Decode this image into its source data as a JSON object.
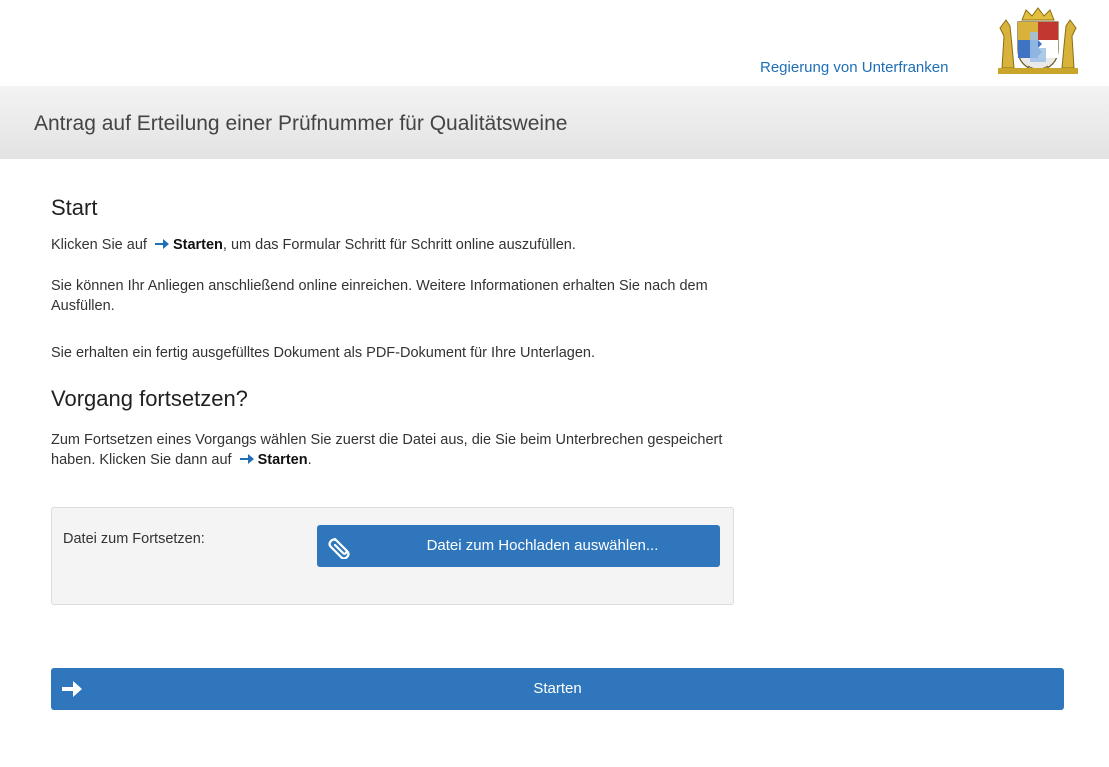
{
  "header": {
    "authority_label": "Regierung von Unterfranken",
    "coat_of_arms_icon": "bavaria-coat-of-arms-icon"
  },
  "title_bar": {
    "title": "Antrag auf Erteilung einer Prüfnummer für Qualitätsweine"
  },
  "start_section": {
    "heading": "Start",
    "para1_before": "Klicken Sie auf",
    "para1_link": "Starten",
    "para1_after": ", um das Formular Schritt für Schritt online auszufüllen.",
    "para2": "Sie können Ihr Anliegen anschließend online einreichen. Weitere Informationen erhalten Sie nach dem Ausfüllen.",
    "para3": "Sie erhalten ein fertig ausgefülltes Dokument als PDF-Dokument für Ihre Unterlagen."
  },
  "continue_section": {
    "heading": "Vorgang fortsetzen?",
    "para_before": "Zum Fortsetzen eines Vorgangs wählen Sie zuerst die Datei aus, die Sie beim Unterbrechen gespeichert haben. Klicken Sie dann auf",
    "para_link": "Starten",
    "para_after": "."
  },
  "upload": {
    "label": "Datei zum Fortsetzen:",
    "button_label": "Datei zum Hochladen auswählen...",
    "button_icon": "paperclip-icon"
  },
  "start_button": {
    "label": "Starten",
    "icon": "arrow-right-icon"
  },
  "colors": {
    "accent": "#2f76bd",
    "link": "#1f6fb7"
  }
}
